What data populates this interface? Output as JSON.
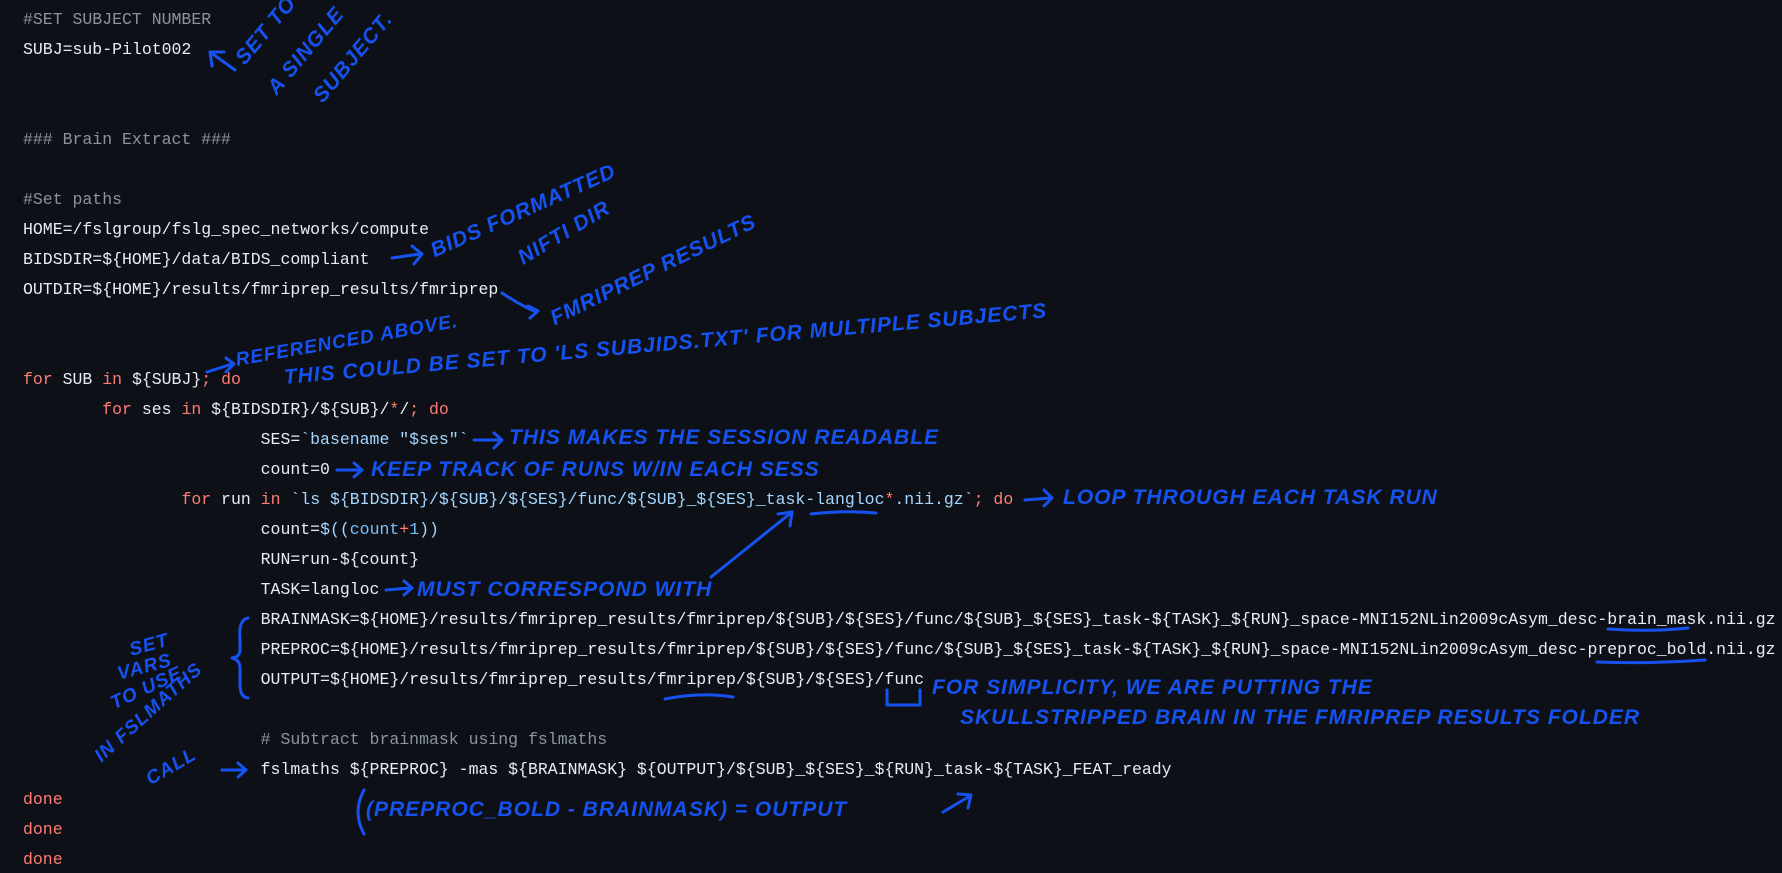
{
  "code": {
    "lines": [
      {
        "tokens": [
          {
            "t": "#SET SUBJECT NUMBER",
            "c": "c"
          }
        ]
      },
      {
        "tokens": [
          {
            "t": "SUBJ=sub-Pilot002",
            "c": "p"
          }
        ]
      },
      {
        "tokens": []
      },
      {
        "tokens": []
      },
      {
        "tokens": [
          {
            "t": "### Brain Extract ###",
            "c": "c"
          }
        ]
      },
      {
        "tokens": []
      },
      {
        "tokens": [
          {
            "t": "#Set paths",
            "c": "c"
          }
        ]
      },
      {
        "tokens": [
          {
            "t": "HOME=/fslgroup/fslg_spec_networks/compute",
            "c": "p"
          }
        ]
      },
      {
        "tokens": [
          {
            "t": "BIDSDIR=${HOME}/data/BIDS_compliant",
            "c": "p"
          }
        ]
      },
      {
        "tokens": [
          {
            "t": "OUTDIR=${HOME}/results/fmriprep_results/fmriprep",
            "c": "p"
          }
        ]
      },
      {
        "tokens": []
      },
      {
        "tokens": []
      },
      {
        "tokens": [
          {
            "t": "for",
            "c": "k"
          },
          {
            "t": " SUB ",
            "c": "p"
          },
          {
            "t": "in",
            "c": "k"
          },
          {
            "t": " ${SUBJ}",
            "c": "p"
          },
          {
            "t": "; do",
            "c": "k"
          }
        ]
      },
      {
        "tokens": [
          {
            "t": "\t",
            "c": "p"
          },
          {
            "t": "for",
            "c": "k"
          },
          {
            "t": " ses ",
            "c": "p"
          },
          {
            "t": "in",
            "c": "k"
          },
          {
            "t": " ${BIDSDIR}/${SUB}/",
            "c": "p"
          },
          {
            "t": "*",
            "c": "k"
          },
          {
            "t": "/",
            "c": "p"
          },
          {
            "t": "; do",
            "c": "k"
          }
        ]
      },
      {
        "tokens": [
          {
            "t": "\t\t\tSES=",
            "c": "p"
          },
          {
            "t": "`basename \"$ses\"`",
            "c": "s"
          }
        ]
      },
      {
        "tokens": [
          {
            "t": "\t\t\tcount=0",
            "c": "p"
          }
        ]
      },
      {
        "tokens": [
          {
            "t": "\t\t",
            "c": "p"
          },
          {
            "t": "for",
            "c": "k"
          },
          {
            "t": " run ",
            "c": "p"
          },
          {
            "t": "in",
            "c": "k"
          },
          {
            "t": " `ls ${BIDSDIR}/${SUB}/${SES}/func/${SUB}_${SES}_task-langloc",
            "c": "s"
          },
          {
            "t": "*",
            "c": "k"
          },
          {
            "t": ".nii.gz`",
            "c": "s"
          },
          {
            "t": "; do",
            "c": "k"
          }
        ]
      },
      {
        "tokens": [
          {
            "t": "\t\t\tcount=",
            "c": "p"
          },
          {
            "t": "$((",
            "c": "s"
          },
          {
            "t": "count",
            "c": "v"
          },
          {
            "t": "+",
            "c": "k"
          },
          {
            "t": "1",
            "c": "v"
          },
          {
            "t": "))",
            "c": "s"
          }
        ]
      },
      {
        "tokens": [
          {
            "t": "\t\t\tRUN=run-${count}",
            "c": "p"
          }
        ]
      },
      {
        "tokens": [
          {
            "t": "\t\t\tTASK=langloc",
            "c": "p"
          }
        ]
      },
      {
        "tokens": [
          {
            "t": "\t\t\tBRAINMASK=${HOME}/results/fmriprep_results/fmriprep/${SUB}/${SES}/func/${SUB}_${SES}_task-${TASK}_${RUN}_space-MNI152NLin2009cAsym_desc-brain_mask.nii.gz",
            "c": "p"
          }
        ]
      },
      {
        "tokens": [
          {
            "t": "\t\t\tPREPROC=${HOME}/results/fmriprep_results/fmriprep/${SUB}/${SES}/func/${SUB}_${SES}_task-${TASK}_${RUN}_space-MNI152NLin2009cAsym_desc-preproc_bold.nii.gz",
            "c": "p"
          }
        ]
      },
      {
        "tokens": [
          {
            "t": "\t\t\tOUTPUT=${HOME}/results/fmriprep_results/fmriprep/${SUB}/${SES}/func",
            "c": "p"
          }
        ]
      },
      {
        "tokens": []
      },
      {
        "tokens": [
          {
            "t": "\t\t\t",
            "c": "p"
          },
          {
            "t": "# Subtract brainmask using fslmaths",
            "c": "c"
          }
        ]
      },
      {
        "tokens": [
          {
            "t": "\t\t\tfslmaths ${PREPROC} -mas ${BRAINMASK} ${OUTPUT}/${SUB}_${SES}_${RUN}_task-${TASK}_FEAT_ready",
            "c": "p"
          }
        ]
      },
      {
        "tokens": [
          {
            "t": "done",
            "c": "k"
          }
        ]
      },
      {
        "tokens": [
          {
            "t": "done",
            "c": "k"
          }
        ]
      },
      {
        "tokens": [
          {
            "t": "done",
            "c": "k"
          }
        ]
      }
    ]
  },
  "annotations": {
    "single_subject": [
      "SET TO",
      "A SINGLE",
      "SUBJECT."
    ],
    "bids": [
      "BIDS FORMATTED",
      "NIFTI DIR"
    ],
    "fmriprep": "FMRIPREP RESULTS",
    "referenced": "REFERENCED ABOVE.",
    "could_be_set": "THIS COULD BE SET TO 'LS SUBJIDS.TXT' FOR MULTIPLE SUBJECTS",
    "session_readable": "THIS MAKES THE SESSION READABLE",
    "keep_track": "KEEP TRACK OF RUNS W/IN EACH SESS",
    "loop": "LOOP THROUGH EACH TASK RUN",
    "must_correspond": "MUST CORRESPOND WITH",
    "set_vars": [
      "SET",
      "VARS",
      "TO USE",
      "IN FSLMATHS",
      "CALL"
    ],
    "simplicity": [
      "FOR SIMPLICITY, WE ARE PUTTING THE",
      "SKULLSTRIPPED BRAIN IN THE FMRIPREP RESULTS FOLDER"
    ],
    "equation": "(PREPROC_BOLD - BRAINMASK) = OUTPUT"
  },
  "colors": {
    "background": "#0d1117",
    "text": "#e6edf3",
    "comment": "#8b949e",
    "keyword": "#ff7b72",
    "string": "#a5d6ff",
    "ink": "#1652f0"
  }
}
